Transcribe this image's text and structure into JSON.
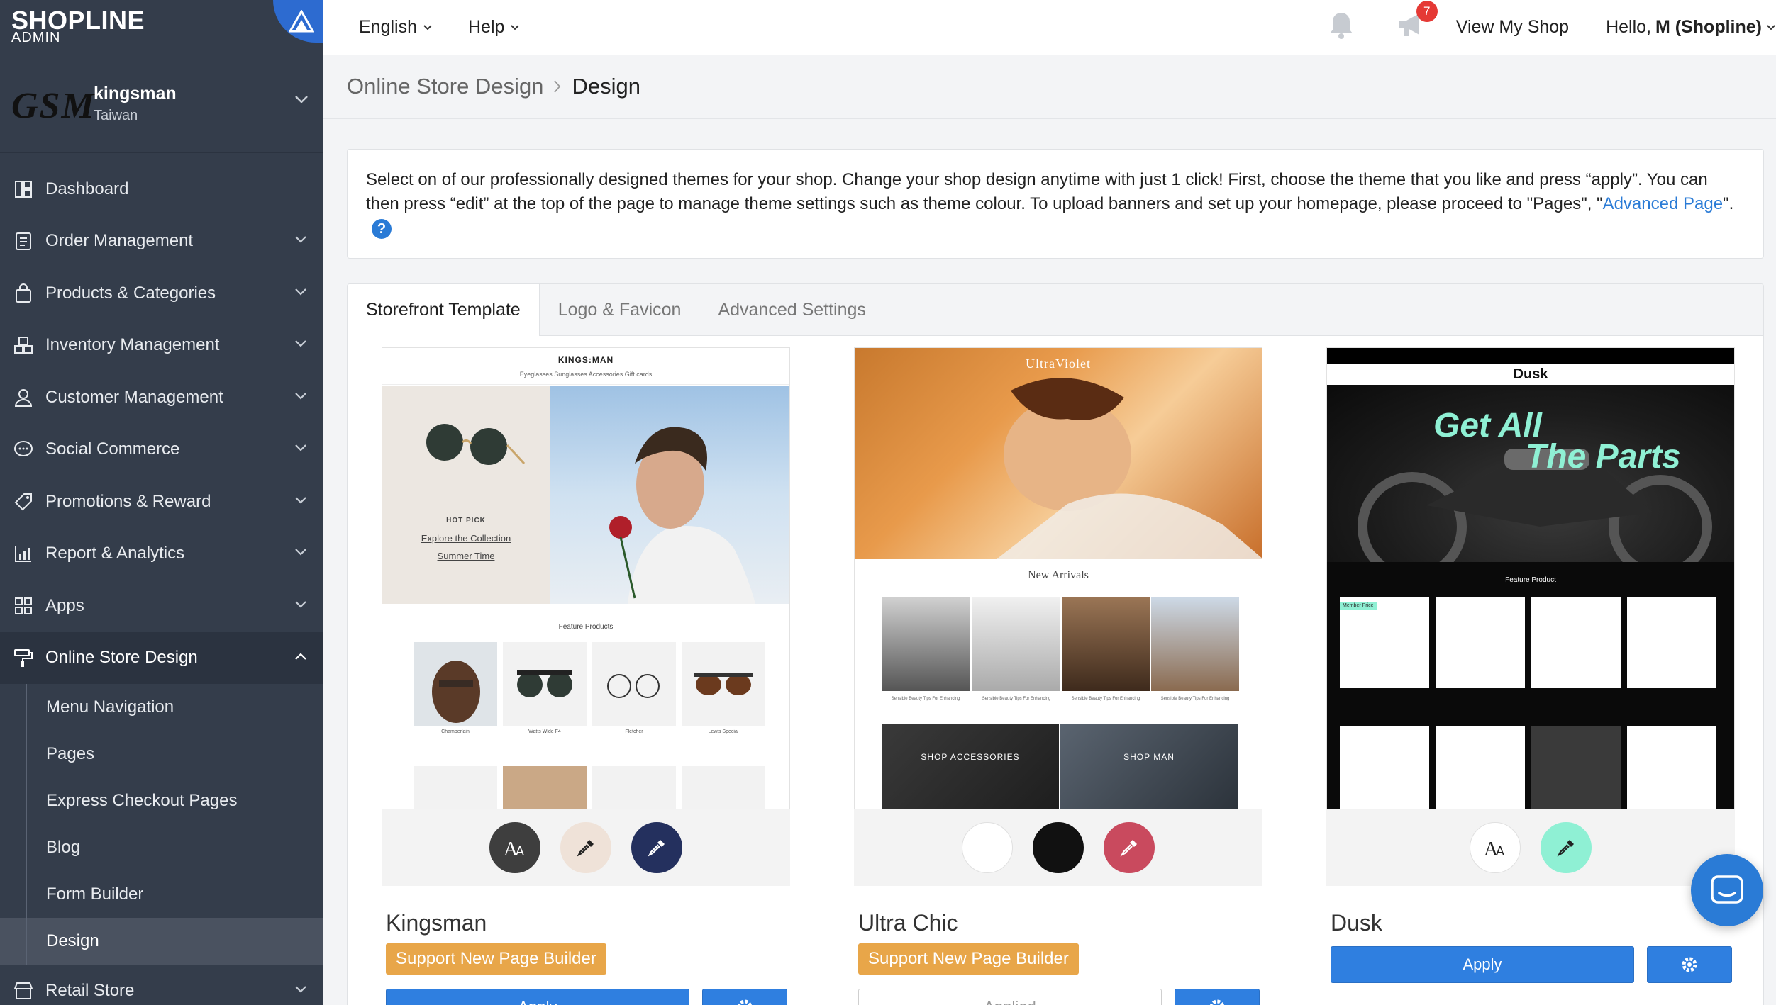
{
  "brand": {
    "logo": "SHOPLINE",
    "sub": "ADMIN"
  },
  "store": {
    "mark": "GSM",
    "name": "kingsman",
    "region": "Taiwan"
  },
  "nav": {
    "items": [
      {
        "label": "Dashboard",
        "icon": "dashboard-icon"
      },
      {
        "label": "Order Management",
        "icon": "clipboard-icon"
      },
      {
        "label": "Products & Categories",
        "icon": "bag-icon"
      },
      {
        "label": "Inventory Management",
        "icon": "inventory-icon"
      },
      {
        "label": "Customer Management",
        "icon": "person-icon"
      },
      {
        "label": "Social Commerce",
        "icon": "chat-icon"
      },
      {
        "label": "Promotions & Reward",
        "icon": "tag-icon"
      },
      {
        "label": "Report & Analytics",
        "icon": "chart-icon"
      },
      {
        "label": "Apps",
        "icon": "apps-icon"
      },
      {
        "label": "Online Store Design",
        "icon": "paint-roller-icon"
      }
    ],
    "sub_items": [
      {
        "label": "Menu Navigation"
      },
      {
        "label": "Pages"
      },
      {
        "label": "Express Checkout Pages"
      },
      {
        "label": "Blog"
      },
      {
        "label": "Form Builder"
      },
      {
        "label": "Design"
      }
    ],
    "retail": {
      "label": "Retail Store",
      "icon": "store-icon"
    }
  },
  "topbar": {
    "language": "English",
    "help": "Help",
    "notification_count": "7",
    "view_shop": "View My Shop",
    "hello_prefix": "Hello,",
    "hello_name": "M (Shopline)"
  },
  "breadcrumb": {
    "parent": "Online Store Design",
    "current": "Design"
  },
  "info": {
    "text_1": "Select on of our professionally designed themes for your shop. Change your shop design anytime with just 1 click! First, choose the theme that you like and press “apply”. You can then press “edit” at the top of the page to manage theme settings such as theme colour. To upload banners and set up your homepage, please proceed to \"Pages\", \"",
    "link": "Advanced Page",
    "text_2": "\".",
    "help_icon": "?"
  },
  "tabs": [
    {
      "label": "Storefront Template"
    },
    {
      "label": "Logo & Favicon"
    },
    {
      "label": "Advanced Settings"
    }
  ],
  "themes": [
    {
      "name": "Kingsman",
      "support": "Support New Page Builder",
      "action": "Apply",
      "preview": {
        "brand": "KINGS:MAN",
        "menu": "Eyeglasses   Sunglasses   Accessories   Gift cards",
        "hot_pick": "HOT PICK",
        "explore": "Explore the Collection",
        "summer": "Summer Time",
        "feature": "Feature Products",
        "products": [
          "Chamberlain",
          "Watts Wide F4",
          "Fletcher",
          "Lewis Special"
        ]
      },
      "swatches": [
        "#3e3e3e",
        "#efe2d8",
        "#24305e"
      ]
    },
    {
      "name": "Ultra Chic",
      "support": "Support New Page Builder",
      "action": "Applied",
      "preview": {
        "brand": "UltraViolet",
        "new_arrivals": "New Arrivals",
        "shop_accessories": "SHOP ACCESSORIES",
        "shop_man": "SHOP MAN",
        "caption": "Sensible Beauty Tips For Enhancing"
      },
      "swatches": [
        "#ffffff",
        "#111111",
        "#c94a5e"
      ]
    },
    {
      "name": "Dusk",
      "action": "Apply",
      "preview": {
        "brand": "Dusk",
        "headline_1": "Get All",
        "headline_2": "The Parts",
        "feature": "Feature Product",
        "member": "Member Price"
      },
      "swatches": [
        "#ffffff",
        "#8ff0d4"
      ]
    }
  ],
  "colors": {
    "sidebar": "#343d4b",
    "accent": "#2f7fe0",
    "support_badge": "#e8a649",
    "badge_red": "#e53935"
  }
}
